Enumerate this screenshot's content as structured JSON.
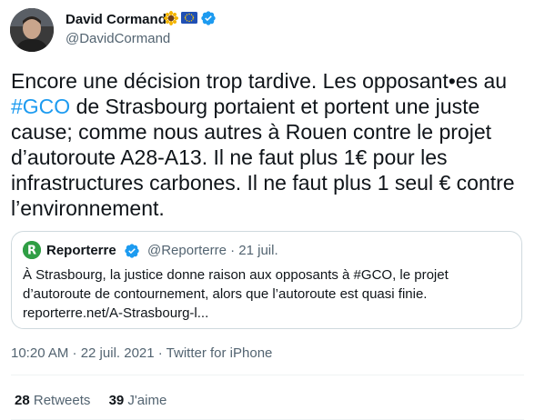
{
  "author": {
    "display_name": "David Cormand",
    "handle": "@DavidCormand",
    "badges": [
      "sunflower-emoji",
      "eu-flag-emoji",
      "verified-badge"
    ]
  },
  "tweet": {
    "text_before": "Encore une décision trop tardive. Les opposant•es au\n",
    "hashtag": "#GCO",
    "text_after": " de Strasbourg portaient et portent une juste\ncause; comme nous autres à Rouen contre le projet\nd’autoroute A28-A13. Il ne faut plus 1€ pour les\ninfrastructures carbones. Il ne faut plus 1 seul € contre\nl’environnement."
  },
  "quoted": {
    "name": "Reporterre",
    "meta": "@Reporterre · 21 juil.",
    "text": "À Strasbourg, la justice donne raison aux opposants à #GCO, le projet\nd’autoroute de contournement, alors que l’autoroute est quasi finie.\nreporterre.net/A-Strasbourg-l..."
  },
  "timestamp": "10:20 AM · 22 juil. 2021 · Twitter for iPhone",
  "stats": {
    "retweets_count": "28",
    "retweets_label": "Retweets",
    "likes_count": "39",
    "likes_label": "J'aime"
  },
  "colors": {
    "accent": "#1d9bf0",
    "text": "#0f1419",
    "secondary": "#536471",
    "border": "#cfd9de",
    "reporterre_green": "#2f9e44"
  }
}
